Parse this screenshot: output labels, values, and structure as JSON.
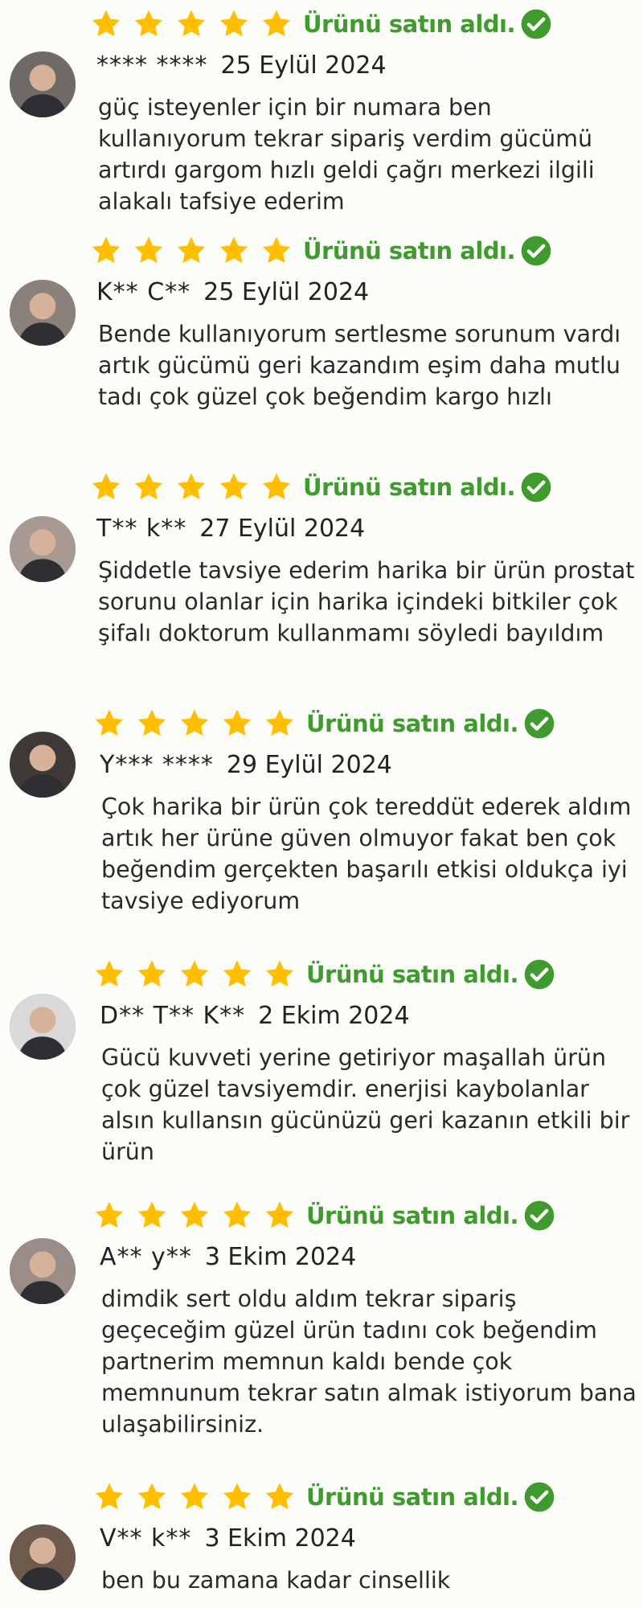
{
  "verified_label": "Ürünü satın aldı.",
  "colors": {
    "star": "#ffbe00",
    "verified": "#3f9b2e",
    "background": "#fcfcf9"
  },
  "icons": {
    "star": "star-icon",
    "verified": "check-circle-icon"
  },
  "reviews": [
    {
      "rating": 5,
      "name": "**** ****",
      "date": "25 Eylül 2024",
      "text": "güç isteyenler için bir numara ben kullanıyorum tekrar sipariş verdim gücümü artırdı gargom hızlı geldi çağrı merkezi ilgili alakalı tafsiye ederim"
    },
    {
      "rating": 5,
      "name": "K** C**",
      "date": "25 Eylül 2024",
      "text": "Bende kullanıyorum sertlesme sorunum vardı artık gücümü geri kazandım eşim daha mutlu tadı çok güzel çok beğendim kargo hızlı"
    },
    {
      "rating": 5,
      "name": "T** k**",
      "date": "27 Eylül 2024",
      "text": "Şiddetle tavsiye ederim harika bir ürün prostat sorunu olanlar için harika içindeki bitkiler çok şifalı doktorum kullanmamı söyledi bayıldım"
    },
    {
      "rating": 5,
      "name": "Y*** ****",
      "date": "29 Eylül 2024",
      "text": "Çok harika bir ürün çok tereddüt ederek aldım artık her ürüne güven olmuyor fakat ben çok beğendim gerçekten başarılı etkisi oldukça iyi tavsiye ediyorum"
    },
    {
      "rating": 5,
      "name": "D** T** K**",
      "date": "2 Ekim 2024",
      "text": "Gücü kuvveti yerine getiriyor maşallah ürün çok güzel tavsiyemdir. enerjisi kaybolanlar alsın kullansın gücünüzü geri kazanın etkili bir ürün"
    },
    {
      "rating": 5,
      "name": "A** y**",
      "date": "3 Ekim 2024",
      "text": "dimdik sert oldu aldım tekrar sipariş geçeceğim güzel ürün tadını cok beğendim partnerim memnun kaldı bende çok memnunum tekrar satın almak istiyorum bana ulaşabilirsiniz."
    },
    {
      "rating": 5,
      "name": "V** k**",
      "date": "3 Ekim 2024",
      "text": "ben bu zamana kadar cinsellik"
    }
  ]
}
